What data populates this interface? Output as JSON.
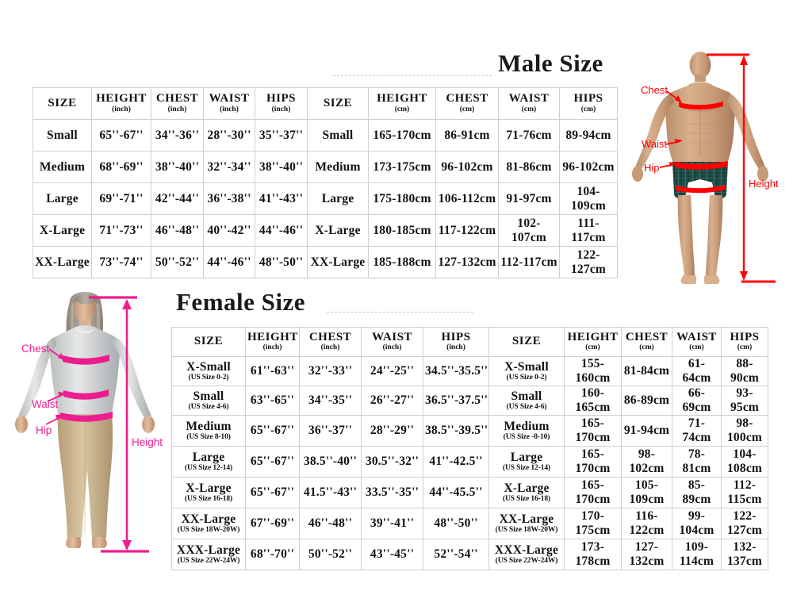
{
  "male": {
    "title": "Male Size",
    "headers_inch": [
      {
        "label": "SIZE",
        "unit": ""
      },
      {
        "label": "HEIGHT",
        "unit": "(inch)"
      },
      {
        "label": "CHEST",
        "unit": "(inch)"
      },
      {
        "label": "WAIST",
        "unit": "(inch)"
      },
      {
        "label": "HIPS",
        "unit": "(inch)"
      }
    ],
    "headers_cm": [
      {
        "label": "SIZE",
        "unit": ""
      },
      {
        "label": "HEIGHT",
        "unit": "(cm)"
      },
      {
        "label": "CHEST",
        "unit": "(cm)"
      },
      {
        "label": "WAIST",
        "unit": "(cm)"
      },
      {
        "label": "HIPS",
        "unit": "(cm)"
      }
    ],
    "rows": [
      {
        "size_inch": "Small",
        "height_inch": "65''-67''",
        "chest_inch": "34''-36''",
        "waist_inch": "28''-30''",
        "hips_inch": "35''-37''",
        "size_cm": "Small",
        "height_cm": "165-170cm",
        "chest_cm": "86-91cm",
        "waist_cm": "71-76cm",
        "hips_cm": "89-94cm"
      },
      {
        "size_inch": "Medium",
        "height_inch": "68''-69''",
        "chest_inch": "38''-40''",
        "waist_inch": "32''-34''",
        "hips_inch": "38''-40''",
        "size_cm": "Medium",
        "height_cm": "173-175cm",
        "chest_cm": "96-102cm",
        "waist_cm": "81-86cm",
        "hips_cm": "96-102cm"
      },
      {
        "size_inch": "Large",
        "height_inch": "69''-71''",
        "chest_inch": "42''-44''",
        "waist_inch": "36''-38''",
        "hips_inch": "41''-43''",
        "size_cm": "Large",
        "height_cm": "175-180cm",
        "chest_cm": "106-112cm",
        "waist_cm": "91-97cm",
        "hips_cm": "104-109cm"
      },
      {
        "size_inch": "X-Large",
        "height_inch": "71''-73''",
        "chest_inch": "46''-48''",
        "waist_inch": "40''-42''",
        "hips_inch": "44''-46''",
        "size_cm": "X-Large",
        "height_cm": "180-185cm",
        "chest_cm": "117-122cm",
        "waist_cm": "102-107cm",
        "hips_cm": "111-117cm"
      },
      {
        "size_inch": "XX-Large",
        "height_inch": "73''-74''",
        "chest_inch": "50''-52''",
        "waist_inch": "44''-46''",
        "hips_inch": "48''-50''",
        "size_cm": "XX-Large",
        "height_cm": "185-188cm",
        "chest_cm": "127-132cm",
        "waist_cm": "112-117cm",
        "hips_cm": "122-127cm"
      }
    ],
    "figure": {
      "chest_label": "Chest",
      "waist_label": "Waist",
      "hip_label": "Hip",
      "height_label": "Height",
      "accent_color": "#ff0000"
    }
  },
  "female": {
    "title": "Female Size",
    "headers_inch": [
      {
        "label": "SIZE",
        "unit": ""
      },
      {
        "label": "HEIGHT",
        "unit": "(inch)"
      },
      {
        "label": "CHEST",
        "unit": "(inch)"
      },
      {
        "label": "WAIST",
        "unit": "(inch)"
      },
      {
        "label": "HIPS",
        "unit": "(inch)"
      }
    ],
    "headers_cm": [
      {
        "label": "SIZE",
        "unit": ""
      },
      {
        "label": "HEIGHT",
        "unit": "(cm)"
      },
      {
        "label": "CHEST",
        "unit": "(cm)"
      },
      {
        "label": "WAIST",
        "unit": "(cm)"
      },
      {
        "label": "HIPS",
        "unit": "(cm)"
      }
    ],
    "rows": [
      {
        "size_inch": "X-Small",
        "us_inch": "(US Size 0-2)",
        "height_inch": "61''-63''",
        "chest_inch": "32''-33''",
        "waist_inch": "24''-25''",
        "hips_inch": "34.5''-35.5''",
        "size_cm": "X-Small",
        "us_cm": "(US Size 0-2)",
        "height_cm": "155-160cm",
        "chest_cm": "81-84cm",
        "waist_cm": "61-64cm",
        "hips_cm": "88-90cm"
      },
      {
        "size_inch": "Small",
        "us_inch": "(US Size 4-6)",
        "height_inch": "63''-65''",
        "chest_inch": "34''-35''",
        "waist_inch": "26''-27''",
        "hips_inch": "36.5''-37.5''",
        "size_cm": "Small",
        "us_cm": "(US Size 4-6)",
        "height_cm": "160-165cm",
        "chest_cm": "86-89cm",
        "waist_cm": "66-69cm",
        "hips_cm": "93-95cm"
      },
      {
        "size_inch": "Medium",
        "us_inch": "(US Size 8-10)",
        "height_inch": "65''-67''",
        "chest_inch": "36''-37''",
        "waist_inch": "28''-29''",
        "hips_inch": "38.5''-39.5''",
        "size_cm": "Medium",
        "us_cm": "(US Size -8-10)",
        "height_cm": "165-170cm",
        "chest_cm": "91-94cm",
        "waist_cm": "71-74cm",
        "hips_cm": "98-100cm"
      },
      {
        "size_inch": "Large",
        "us_inch": "(US Size 12-14)",
        "height_inch": "65''-67''",
        "chest_inch": "38.5''-40''",
        "waist_inch": "30.5''-32''",
        "hips_inch": "41''-42.5''",
        "size_cm": "Large",
        "us_cm": "(US Size 12-14)",
        "height_cm": "165-170cm",
        "chest_cm": "98-102cm",
        "waist_cm": "78-81cm",
        "hips_cm": "104-108cm"
      },
      {
        "size_inch": "X-Large",
        "us_inch": "(US Size 16-18)",
        "height_inch": "65''-67''",
        "chest_inch": "41.5''-43''",
        "waist_inch": "33.5''-35''",
        "hips_inch": "44''-45.5''",
        "size_cm": "X-Large",
        "us_cm": "(US Size 16-18)",
        "height_cm": "165-170cm",
        "chest_cm": "105-109cm",
        "waist_cm": "85-89cm",
        "hips_cm": "112-115cm"
      },
      {
        "size_inch": "XX-Large",
        "us_inch": "(US Size 18W-20W)",
        "height_inch": "67''-69''",
        "chest_inch": "46''-48''",
        "waist_inch": "39''-41''",
        "hips_inch": "48''-50''",
        "size_cm": "XX-Large",
        "us_cm": "(US Size 18W-20W)",
        "height_cm": "170-175cm",
        "chest_cm": "116-122cm",
        "waist_cm": "99-104cm",
        "hips_cm": "122-127cm"
      },
      {
        "size_inch": "XXX-Large",
        "us_inch": "(US Size 22W-24W)",
        "height_inch": "68''-70''",
        "chest_inch": "50''-52''",
        "waist_inch": "43''-45''",
        "hips_inch": "52''-54''",
        "size_cm": "XXX-Large",
        "us_cm": "(US Size 22W-24W)",
        "height_cm": "173-178cm",
        "chest_cm": "127-132cm",
        "waist_cm": "109-114cm",
        "hips_cm": "132-137cm"
      }
    ],
    "figure": {
      "chest_label": "Chest",
      "waist_label": "Waist",
      "hip_label": "Hip",
      "height_label": "Height",
      "accent_color": "#ee1d8f"
    }
  }
}
